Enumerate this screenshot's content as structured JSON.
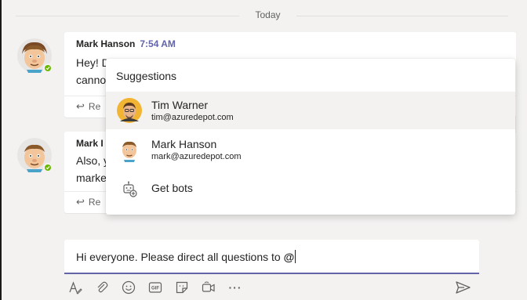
{
  "divider": {
    "label": "Today"
  },
  "messages": [
    {
      "author": "Mark Hanson",
      "time": "7:54 AM",
      "line1": "Hey! D",
      "line2": "canno",
      "reply_label": "Re"
    },
    {
      "author": "Mark I",
      "line1": "Also, y",
      "line2": "marke",
      "reply_label": "Re"
    }
  ],
  "suggestions": {
    "title": "Suggestions",
    "items": [
      {
        "name": "Tim Warner",
        "email": "tim@azuredepot.com",
        "active": true
      },
      {
        "name": "Mark Hanson",
        "email": "mark@azuredepot.com",
        "active": false
      }
    ],
    "bots_label": "Get bots"
  },
  "compose": {
    "text": "Hi everyone. Please direct all questions to ",
    "mention_char": "@"
  },
  "toolbar": {
    "icons": [
      "format-icon",
      "attach-icon",
      "emoji-icon",
      "gif-icon",
      "sticker-icon",
      "meet-now-icon",
      "more-options-icon"
    ],
    "gif_text": "GIF",
    "more_text": "···"
  },
  "colors": {
    "accent": "#6264a7",
    "presence_available": "#6bb700",
    "background": "#f3f2f1"
  }
}
